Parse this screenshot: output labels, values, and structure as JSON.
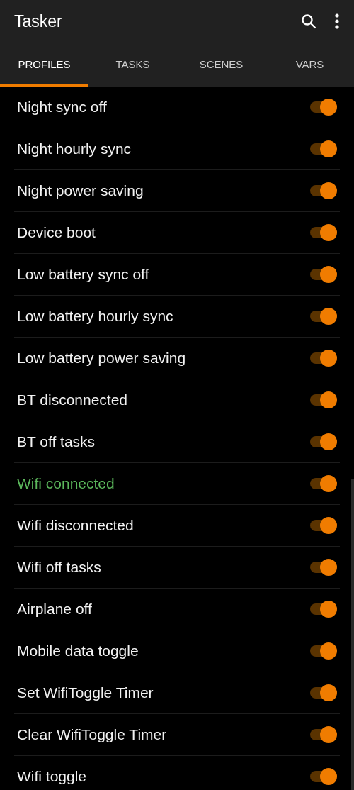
{
  "app_bar": {
    "title": "Tasker"
  },
  "tabs": [
    {
      "label": "PROFILES",
      "selected": true
    },
    {
      "label": "TASKS",
      "selected": false
    },
    {
      "label": "SCENES",
      "selected": false
    },
    {
      "label": "VARS",
      "selected": false
    }
  ],
  "profiles": [
    {
      "name": "Night sync off",
      "active": false,
      "on": true
    },
    {
      "name": "Night hourly sync",
      "active": false,
      "on": true
    },
    {
      "name": "Night power saving",
      "active": false,
      "on": true
    },
    {
      "name": "Device boot",
      "active": false,
      "on": true
    },
    {
      "name": "Low battery sync off",
      "active": false,
      "on": true
    },
    {
      "name": "Low battery hourly sync",
      "active": false,
      "on": true
    },
    {
      "name": "Low battery power saving",
      "active": false,
      "on": true
    },
    {
      "name": "BT disconnected",
      "active": false,
      "on": true
    },
    {
      "name": "BT off tasks",
      "active": false,
      "on": true
    },
    {
      "name": "Wifi connected",
      "active": true,
      "on": true
    },
    {
      "name": "Wifi disconnected",
      "active": false,
      "on": true
    },
    {
      "name": "Wifi off tasks",
      "active": false,
      "on": true
    },
    {
      "name": "Airplane off",
      "active": false,
      "on": true
    },
    {
      "name": "Mobile data toggle",
      "active": false,
      "on": true
    },
    {
      "name": "Set WifiToggle Timer",
      "active": false,
      "on": true
    },
    {
      "name": "Clear WifiToggle Timer",
      "active": false,
      "on": true
    },
    {
      "name": "Wifi toggle",
      "active": false,
      "on": true
    }
  ]
}
